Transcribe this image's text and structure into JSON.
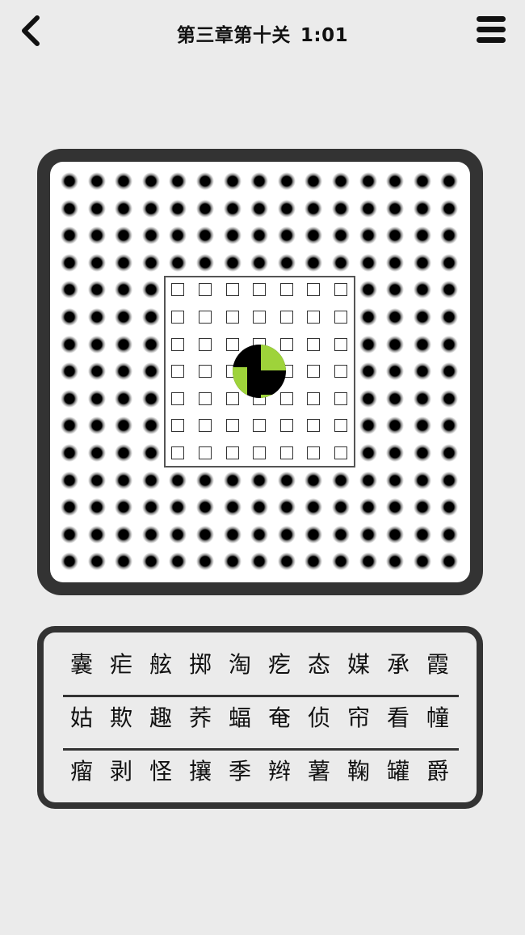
{
  "header": {
    "back_icon": "chevron-left-icon",
    "level_title": "第三章第十关",
    "timer": "1:01",
    "menu_icon": "hamburger-menu-icon"
  },
  "board": {
    "rows": 15,
    "cols": 15,
    "hole_color": "#000000",
    "frame_color": "#333333",
    "revealed_grid": {
      "rows": 7,
      "cols": 7
    },
    "player": {
      "colors": [
        "#000000",
        "#9ed33a"
      ],
      "row": 7,
      "col": 7
    }
  },
  "characters": {
    "rows": [
      [
        "囊",
        "疟",
        "舷",
        "掷",
        "淘",
        "疙",
        "态",
        "媒",
        "承",
        "霞"
      ],
      [
        "姑",
        "欺",
        "趣",
        "荞",
        "蝠",
        "奄",
        "侦",
        "帘",
        "看",
        "幢"
      ],
      [
        "瘤",
        "剥",
        "怪",
        "攘",
        "季",
        "辫",
        "薯",
        "鞠",
        "罐",
        "爵"
      ]
    ]
  }
}
